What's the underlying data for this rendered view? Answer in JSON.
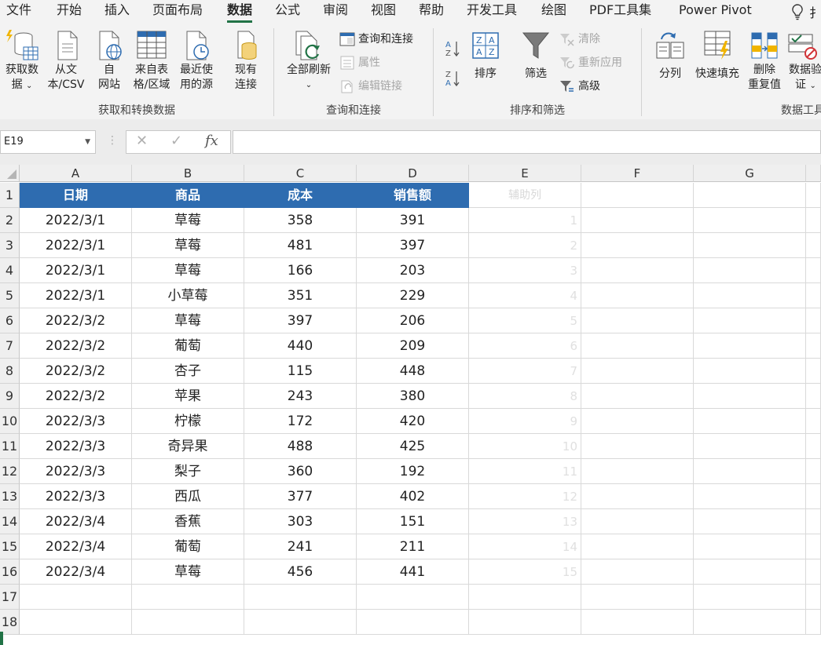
{
  "menu": {
    "tabs": [
      "文件",
      "开始",
      "插入",
      "页面布局",
      "数据",
      "公式",
      "审阅",
      "视图",
      "帮助",
      "开发工具",
      "绘图",
      "PDF工具集",
      "Power Pivot"
    ],
    "active_tab": "数据",
    "partial_tab": "扌"
  },
  "ribbon": {
    "get_transform": {
      "group_label": "获取和转换数据",
      "get_data": [
        "获取数",
        "据"
      ],
      "from_csv": [
        "从文",
        "本/CSV"
      ],
      "from_web": [
        "自",
        "网站"
      ],
      "from_table": [
        "来自表",
        "格/区域"
      ],
      "recent_sources": [
        "最近使",
        "用的源"
      ],
      "existing_connections": [
        "现有",
        "连接"
      ]
    },
    "queries": {
      "group_label": "查询和连接",
      "refresh_all": "全部刷新",
      "queries_connections": "查询和连接",
      "properties": "属性",
      "edit_links": "编辑链接"
    },
    "sort_filter": {
      "group_label": "排序和筛选",
      "sort": "排序",
      "filter": "筛选",
      "clear": "清除",
      "reapply": "重新应用",
      "advanced": "高级"
    },
    "data_tools": {
      "group_label": "数据工具",
      "text_to_columns": "分列",
      "flash_fill": "快速填充",
      "remove_duplicates": [
        "删除",
        "重复值"
      ],
      "validation": [
        "数据验",
        "证"
      ]
    }
  },
  "formula_bar": {
    "name_box": "E19",
    "fx": "fx",
    "formula": ""
  },
  "sheet": {
    "columns": [
      "A",
      "B",
      "C",
      "D",
      "E",
      "F",
      "G"
    ],
    "row_numbers": [
      "1",
      "2",
      "3",
      "4",
      "5",
      "6",
      "7",
      "8",
      "9",
      "10",
      "11",
      "12",
      "13",
      "14",
      "15",
      "16",
      "17",
      "18"
    ],
    "headers": [
      "日期",
      "商品",
      "成本",
      "销售额"
    ],
    "helper_header": "辅助列",
    "rows": [
      [
        "2022/3/1",
        "草莓",
        "358",
        "391",
        "1"
      ],
      [
        "2022/3/1",
        "草莓",
        "481",
        "397",
        "2"
      ],
      [
        "2022/3/1",
        "草莓",
        "166",
        "203",
        "3"
      ],
      [
        "2022/3/1",
        "小草莓",
        "351",
        "229",
        "4"
      ],
      [
        "2022/3/2",
        "草莓",
        "397",
        "206",
        "5"
      ],
      [
        "2022/3/2",
        "葡萄",
        "440",
        "209",
        "6"
      ],
      [
        "2022/3/2",
        "杏子",
        "115",
        "448",
        "7"
      ],
      [
        "2022/3/2",
        "苹果",
        "243",
        "380",
        "8"
      ],
      [
        "2022/3/3",
        "柠檬",
        "172",
        "420",
        "9"
      ],
      [
        "2022/3/3",
        "奇异果",
        "488",
        "425",
        "10"
      ],
      [
        "2022/3/3",
        "梨子",
        "360",
        "192",
        "11"
      ],
      [
        "2022/3/3",
        "西瓜",
        "377",
        "402",
        "12"
      ],
      [
        "2022/3/4",
        "香蕉",
        "303",
        "151",
        "13"
      ],
      [
        "2022/3/4",
        "葡萄",
        "241",
        "211",
        "14"
      ],
      [
        "2022/3/4",
        "草莓",
        "456",
        "441",
        "15"
      ]
    ]
  },
  "colors": {
    "header_fill": "#2e6cb0",
    "accent": "#217346"
  }
}
